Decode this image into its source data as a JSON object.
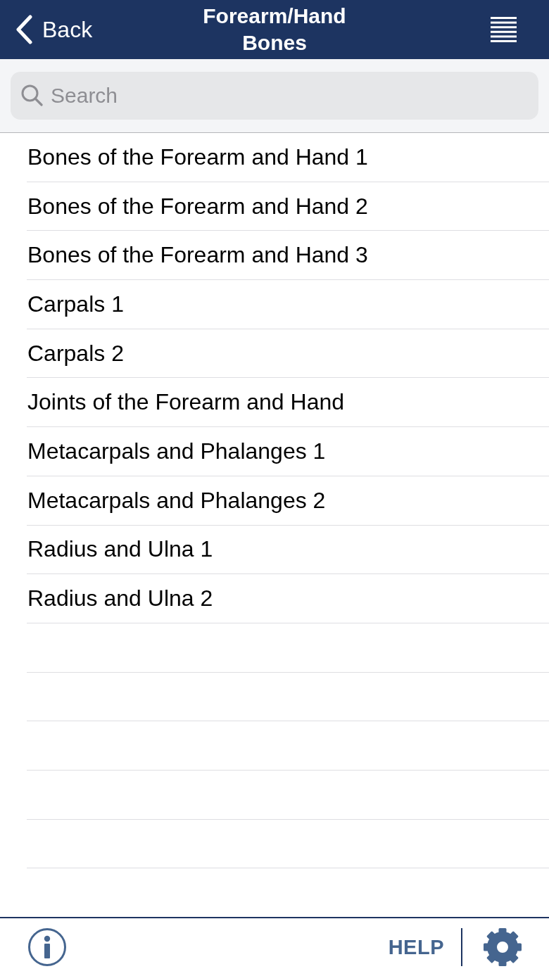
{
  "header": {
    "back_label": "Back",
    "title": "Forearm/Hand Bones"
  },
  "search": {
    "placeholder": "Search"
  },
  "topics": [
    {
      "label": "Bones of the Forearm and Hand 1"
    },
    {
      "label": "Bones of the Forearm and Hand 2"
    },
    {
      "label": "Bones of the Forearm and Hand 3"
    },
    {
      "label": "Carpals 1"
    },
    {
      "label": "Carpals 2"
    },
    {
      "label": "Joints of the Forearm and Hand"
    },
    {
      "label": "Metacarpals and Phalanges 1"
    },
    {
      "label": "Metacarpals and Phalanges 2"
    },
    {
      "label": "Radius and Ulna 1"
    },
    {
      "label": "Radius and Ulna 2"
    }
  ],
  "footer": {
    "help_label": "HELP"
  }
}
